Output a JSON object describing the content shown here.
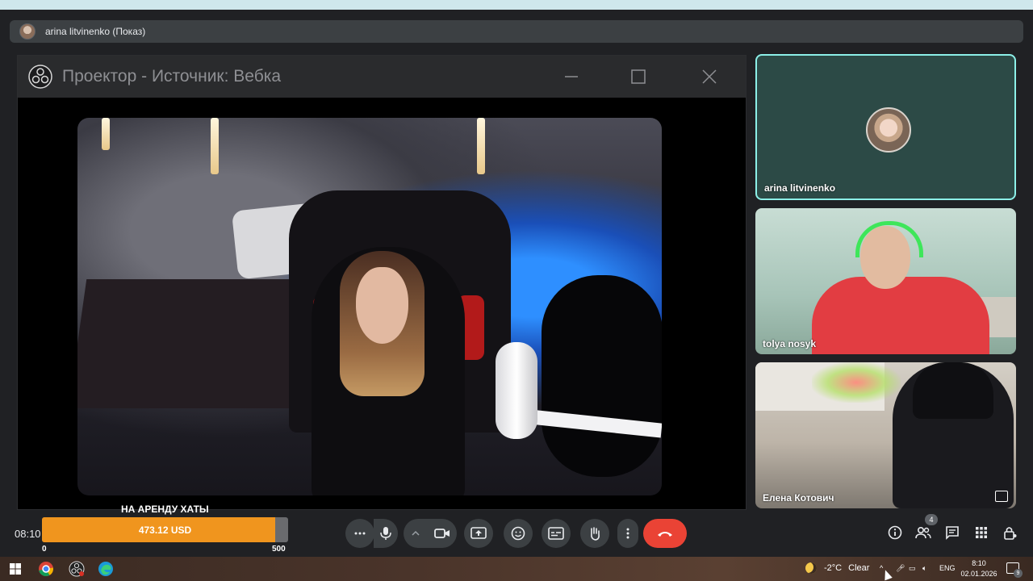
{
  "presentation_bar": {
    "presenter": "arina litvinenko (Показ)"
  },
  "projector": {
    "title": "Проектор - Источник: Вебка",
    "minimize_glyph": "—",
    "maximize_glyph": "☐",
    "close_glyph": "✕"
  },
  "participants": [
    {
      "name": "arina litvinenko"
    },
    {
      "name": "tolya nosyk"
    },
    {
      "name": "Елена Котович"
    }
  ],
  "donation": {
    "title": "НА АРЕНДУ ХАТЫ",
    "amount": "473.12 USD",
    "progress": 0.946,
    "min": "0",
    "max": "500",
    "fill_color": "#f0951e"
  },
  "meeting": {
    "time": "08:10"
  },
  "controls": {
    "more_icon": "more-horizontal-icon",
    "mic_icon": "mic-icon",
    "camera_icon": "videocam-icon",
    "share_icon": "present-screen-icon",
    "emoji_icon": "emoji-icon",
    "captions_icon": "captions-icon",
    "hand_icon": "raise-hand-icon",
    "options_icon": "more-vertical-icon",
    "end_call_icon": "call-end-icon",
    "end_call_color": "#ea4335"
  },
  "side_controls": {
    "people_count": "4"
  },
  "taskbar": {
    "weather": "-2°C",
    "weather_desc": "Clear",
    "language": "ENG",
    "time": "8:10",
    "date": "02.01.2026",
    "notifications": "9"
  },
  "colors": {
    "active_speaker_border": "#8cf0e8",
    "meet_background": "#202124",
    "control_background": "#3c4043"
  }
}
